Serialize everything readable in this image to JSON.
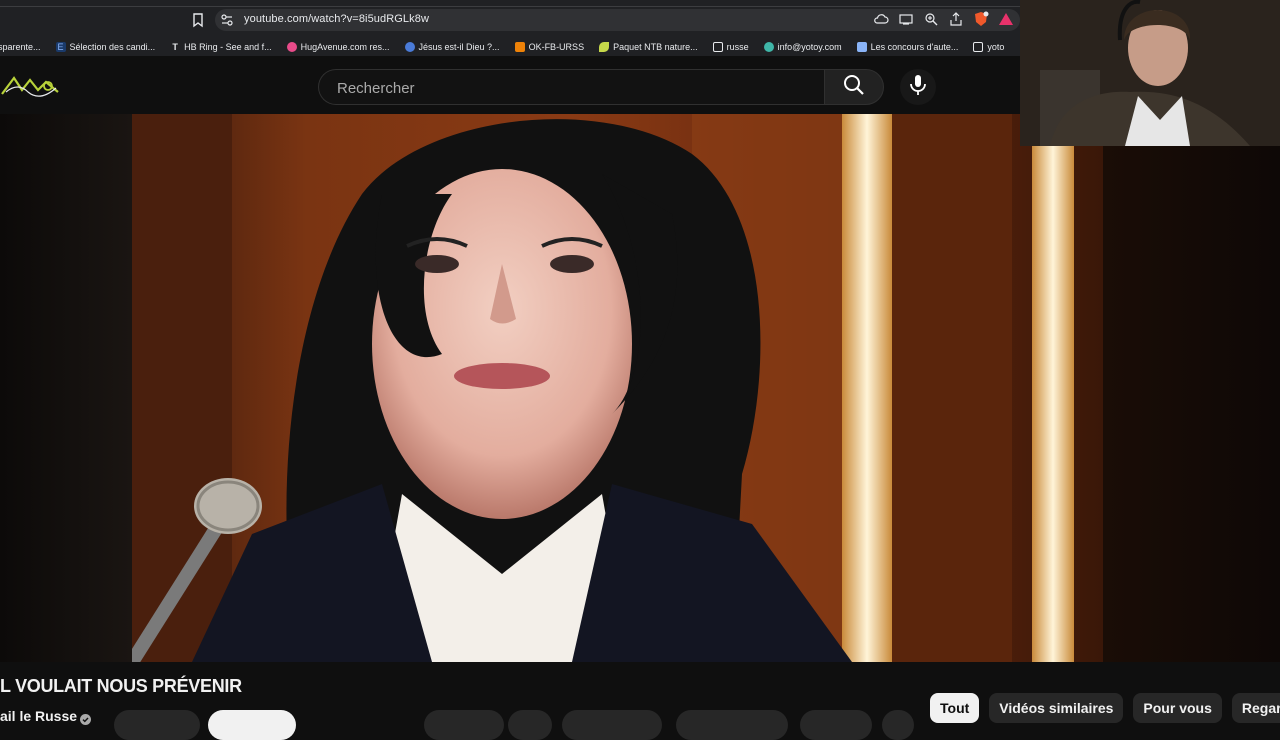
{
  "browser": {
    "url": "youtube.com/watch?v=8i5udRGLk8w",
    "bookmarks": [
      {
        "label": "sparente...",
        "icon": "page-icon",
        "color": "#5f6368"
      },
      {
        "label": "Sélection des candi...",
        "icon": "e-icon",
        "color": "#8ab4f8"
      },
      {
        "label": "HB Ring - See and f...",
        "icon": "t-icon",
        "color": "#e8eaed"
      },
      {
        "label": "HugAvenue.com res...",
        "icon": "heart-icon",
        "color": "#e94b8a"
      },
      {
        "label": "Jésus est-il Dieu ?...",
        "icon": "globe-icon",
        "color": "#4a7bd8"
      },
      {
        "label": "OK-FB-URSS",
        "icon": "ok-icon",
        "color": "#ee8208"
      },
      {
        "label": "Paquet NTB nature...",
        "icon": "leaf-icon",
        "color": "#c6d84a"
      },
      {
        "label": "russe",
        "icon": "folder-icon",
        "color": "#e8eaed"
      },
      {
        "label": "info@yotoy.com",
        "icon": "mail-icon",
        "color": "#3fb6a8"
      },
      {
        "label": "Les concours d'aute...",
        "icon": "site-icon",
        "color": "#8ab4f8"
      },
      {
        "label": "yoto",
        "icon": "folder-icon",
        "color": "#e8eaed"
      }
    ]
  },
  "header": {
    "search_placeholder": "Rechercher"
  },
  "video": {
    "title": "L VOULAIT NOUS PRÉVENIR",
    "channel": "ail le Russe"
  },
  "chips": [
    {
      "label": "Tout",
      "active": true
    },
    {
      "label": "Vidéos similaires",
      "active": false
    },
    {
      "label": "Pour vous",
      "active": false
    },
    {
      "label": "Regardées",
      "active": false
    }
  ],
  "colors": {
    "background": "#0f0f0f",
    "browser_chrome": "#202124",
    "chip_bg": "#272727",
    "chip_active_bg": "#f1f1f1"
  }
}
